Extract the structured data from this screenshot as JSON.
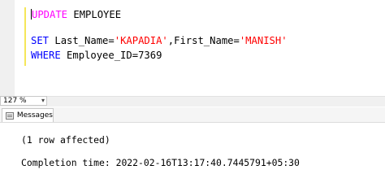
{
  "editor": {
    "line1": {
      "keyword": "UPDATE",
      "rest": " EMPLOYEE"
    },
    "line2": {
      "kw": "SET",
      "part1": " Last_Name=",
      "val1": "'KAPADIA'",
      "part2": ",First_Name=",
      "val2": "'MANISH'"
    },
    "line3": {
      "kw": "WHERE",
      "rest": " Employee_ID=7369"
    }
  },
  "status": {
    "zoom": "127 %"
  },
  "results": {
    "tab_label": "Messages",
    "lines": [
      "(1 row affected)",
      "Completion time: 2022-02-16T13:17:40.7445791+05:30"
    ]
  },
  "colors": {
    "keyword": "#0000ff",
    "string": "#ff0000",
    "update_keyword": "#ff00ff"
  }
}
